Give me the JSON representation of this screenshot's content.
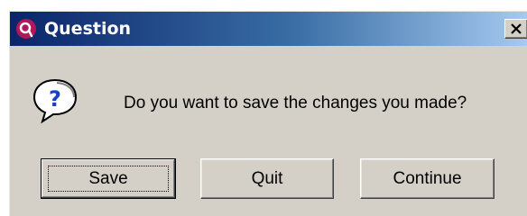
{
  "window": {
    "title": "Question",
    "icons": {
      "app": "app-logo-icon",
      "close": "close-icon",
      "message": "question-icon"
    }
  },
  "message": {
    "text": "Do you want to save the changes you made?"
  },
  "buttons": {
    "save_label": "Save",
    "quit_label": "Quit",
    "continue_label": "Continue"
  },
  "colors": {
    "titlebar_start": "#0a246a",
    "titlebar_end": "#a6caf0",
    "dialog_background": "#d4d0c8",
    "app_icon": "#b0185a"
  }
}
